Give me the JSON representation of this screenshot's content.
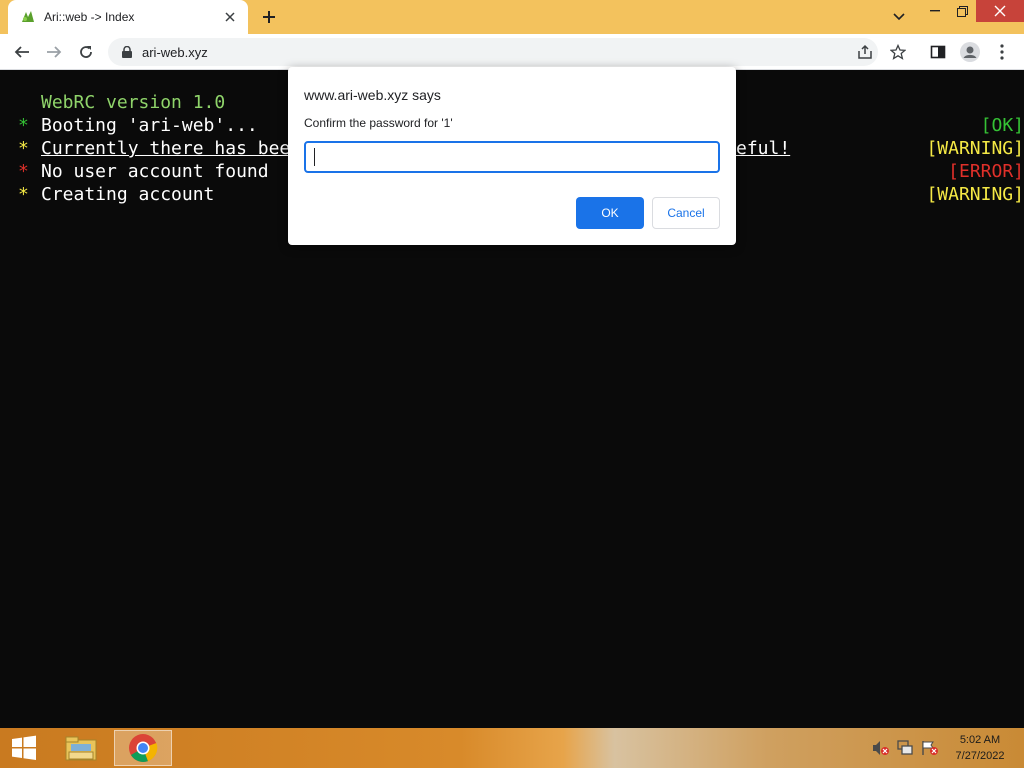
{
  "browser": {
    "tab_title": "Ari::web -> Index",
    "url": "ari-web.xyz"
  },
  "terminal": {
    "header": "WebRC version 1.0",
    "lines": [
      {
        "bullet": "*",
        "text": "Booting 'ari-web'...",
        "status": "[OK]",
        "bullet_color": "#35c235",
        "status_color": "#35c235"
      },
      {
        "bullet": "*",
        "text_left": "Currently there has bee",
        "text_right": "eful!",
        "status": "[WARNING]",
        "bullet_color": "#f5e945",
        "status_color": "#f5e945"
      },
      {
        "bullet": "*",
        "text": "No user account found",
        "status": "[ERROR]",
        "bullet_color": "#e0302a",
        "status_color": "#e0302a"
      },
      {
        "bullet": "*",
        "text": "Creating account",
        "status": "[WARNING]",
        "bullet_color": "#f5e945",
        "status_color": "#f5e945"
      }
    ]
  },
  "dialog": {
    "title": "www.ari-web.xyz says",
    "message": "Confirm the password for '1'",
    "input_value": "",
    "ok_label": "OK",
    "cancel_label": "Cancel"
  },
  "taskbar": {
    "time": "5:02 AM",
    "date": "7/27/2022"
  },
  "colors": {
    "accent": "#1a73e8",
    "tabstrip": "#f3c25d",
    "terminal_bg": "#0a0a0a"
  }
}
